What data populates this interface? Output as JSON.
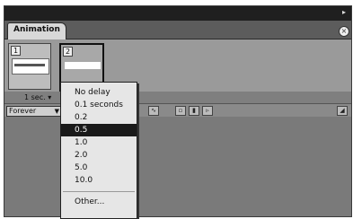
{
  "panel": {
    "tab_label": "Animation",
    "close_glyph": "×"
  },
  "frames": [
    {
      "number": "1",
      "delay": "1 sec. ▾"
    },
    {
      "number": "2"
    }
  ],
  "toolbar": {
    "loop_value": "Forever",
    "loop_arrow": "▼",
    "icons": [
      "tween-icon",
      "new-frame-icon",
      "delete-frame-icon",
      "play-icon"
    ]
  },
  "delay_menu": {
    "items": [
      "No delay",
      "0.1 seconds",
      "0.2",
      "0.5",
      "1.0",
      "2.0",
      "5.0",
      "10.0",
      "Other..."
    ],
    "selected": "0.5"
  }
}
